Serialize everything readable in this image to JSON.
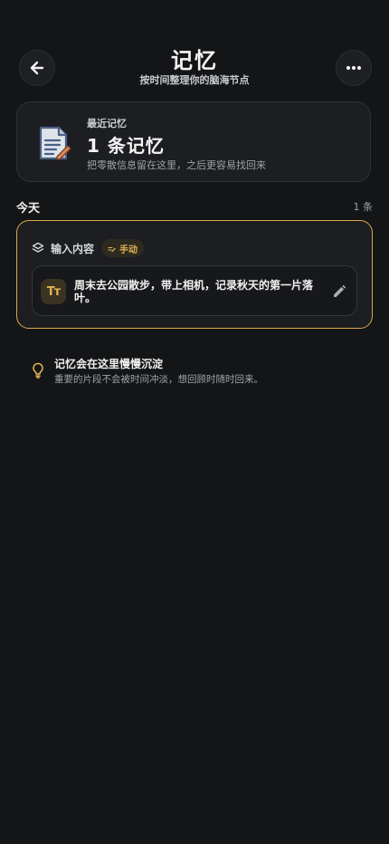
{
  "header": {
    "title": "记忆",
    "subtitle": "按时间整理你的脑海节点"
  },
  "summary": {
    "label": "最近记忆",
    "count_text": "1 条记忆",
    "description": "把零散信息留在这里，之后更容易找回来"
  },
  "section": {
    "title": "今天",
    "count": "1 条"
  },
  "entry": {
    "type_label": "输入内容",
    "badge": "手动",
    "content": "周末去公园散步，带上相机，记录秋天的第一片落叶。",
    "type_icon": "Tт"
  },
  "tip": {
    "title": "记忆会在这里慢慢沉淀",
    "description": "重要的片段不会被时间冲淡，想回顾时随时回来。"
  },
  "colors": {
    "background": "#141517",
    "card": "#1c1e21",
    "accent": "#e4b355",
    "highlight_border": "#d8a84a"
  },
  "icons": {
    "back": "arrow-left-icon",
    "more": "more-horizontal-icon",
    "summary": "document-edit-icon",
    "entry_type": "layers-icon",
    "badge": "manual-edit-icon",
    "content_type": "text-size-icon",
    "edit": "pencil-icon",
    "tip": "lightbulb-icon"
  }
}
